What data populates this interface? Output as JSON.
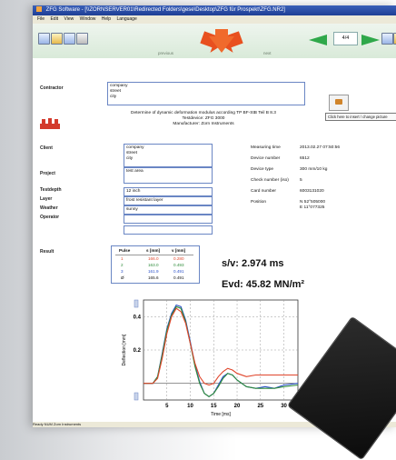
{
  "window": {
    "title": "ZFG Software - [\\\\ZORNSERVER01\\Redirected Folders\\gese\\Desktop\\ZFG für Prospekt\\ZFG.NR2]",
    "menu": [
      "File",
      "Edit",
      "View",
      "Window",
      "Help",
      "Language"
    ],
    "page_indicator": "4/4",
    "toolbar_hints": {
      "left": "previous",
      "right": "next"
    },
    "status": "Ready  NUM  Zorn Instruments"
  },
  "report": {
    "contractor_label": "Contractor",
    "contractor_lines": [
      "company",
      "street",
      "city"
    ],
    "heading_lines": [
      "Determine of dynamic deformation modulus according TP BF-StB Teil B 8.3",
      "Testdevice: ZFG 3000",
      "Manufacturer: Zorn Instruments"
    ],
    "insert_button": "Click here to insert / change picture",
    "client_label": "Client",
    "client_lines": [
      "company",
      "street",
      "city"
    ],
    "project_label": "Project",
    "project_value": "test area",
    "testdepth_label": "Testdepth",
    "testdepth_value": "12 inch",
    "layer_label": "Layer",
    "layer_value": "frost resistant layer",
    "weather_label": "Weather",
    "weather_value": "sunny",
    "operator_label": "Operator",
    "operator_value": "",
    "meta": [
      {
        "key": "Measuring time",
        "value": "2013.02.27 07:50:56"
      },
      {
        "key": "Device number",
        "value": "6512"
      },
      {
        "key": "Device type",
        "value": "300 mm/10 kg"
      },
      {
        "key": "Check number (iso)",
        "value": "5"
      },
      {
        "key": "Card number",
        "value": "6003131020"
      },
      {
        "key": "Position",
        "value": "N 52°505000\nE 11°077325"
      }
    ],
    "result_label": "Result",
    "pulse_table": {
      "headers": [
        "Pulse",
        "s [mm]",
        "v [mm]"
      ],
      "rows": [
        {
          "pulse": "1",
          "s": "166.0",
          "v": "0.280",
          "color": "#e0452b"
        },
        {
          "pulse": "2",
          "s": "163.0",
          "v": "0.493",
          "color": "#2e8b3a"
        },
        {
          "pulse": "3",
          "s": "161.9",
          "v": "0.491",
          "color": "#2b50c8"
        },
        {
          "pulse": "Ø",
          "s": "165.6",
          "v": "0.491",
          "color": "#111111"
        }
      ]
    },
    "sv_text": "s/v: 2.974 ms",
    "evd_text": "Evd: 45.82 MN/m²"
  },
  "chart_data": {
    "type": "line",
    "xlabel": "Time [ms]",
    "ylabel": "Deflection [mm]",
    "xlim": [
      0,
      33
    ],
    "ylim": [
      0.5,
      -0.1
    ],
    "xticks": [
      5,
      10,
      15,
      20,
      25,
      30
    ],
    "yticks": [
      0.2,
      0.4
    ],
    "series": [
      {
        "color": "#2b50c8",
        "x": [
          0,
          2,
          3,
          4,
          5,
          6,
          7,
          8,
          9,
          10,
          11,
          12,
          13,
          14,
          15,
          16,
          17,
          18,
          19,
          20,
          22,
          24,
          26,
          28,
          30,
          33
        ],
        "y": [
          0,
          0,
          0.04,
          0.18,
          0.33,
          0.42,
          0.47,
          0.46,
          0.38,
          0.25,
          0.11,
          0.01,
          -0.06,
          -0.08,
          -0.06,
          -0.01,
          0.04,
          0.06,
          0.05,
          0.02,
          -0.02,
          -0.03,
          -0.02,
          -0.03,
          -0.01,
          0
        ]
      },
      {
        "color": "#2e8b3a",
        "x": [
          0,
          2,
          3,
          4,
          5,
          6,
          7,
          8,
          9,
          10,
          11,
          12,
          13,
          14,
          15,
          16,
          17,
          18,
          19,
          20,
          22,
          24,
          26,
          28,
          30,
          33
        ],
        "y": [
          0,
          0,
          0.04,
          0.17,
          0.32,
          0.41,
          0.46,
          0.45,
          0.37,
          0.24,
          0.1,
          0.0,
          -0.06,
          -0.08,
          -0.06,
          -0.02,
          0.03,
          0.06,
          0.05,
          0.02,
          -0.02,
          -0.03,
          -0.03,
          -0.03,
          -0.02,
          -0.01
        ]
      },
      {
        "color": "#e0452b",
        "x": [
          0,
          2,
          3,
          4,
          5,
          6,
          7,
          8,
          9,
          10,
          11,
          12,
          13,
          14,
          15,
          16,
          17,
          18,
          19,
          20,
          22,
          24,
          26,
          28,
          30,
          33
        ],
        "y": [
          0,
          0,
          0.03,
          0.15,
          0.3,
          0.4,
          0.45,
          0.43,
          0.36,
          0.24,
          0.12,
          0.04,
          0.0,
          -0.01,
          0.0,
          0.04,
          0.07,
          0.09,
          0.08,
          0.06,
          0.04,
          0.05,
          0.05,
          0.05,
          0.05,
          0.05
        ]
      }
    ]
  },
  "colors": {
    "accent_orange": "#e8501f",
    "box_border": "#6a86c4",
    "title_blue": "#2b4aa7"
  }
}
